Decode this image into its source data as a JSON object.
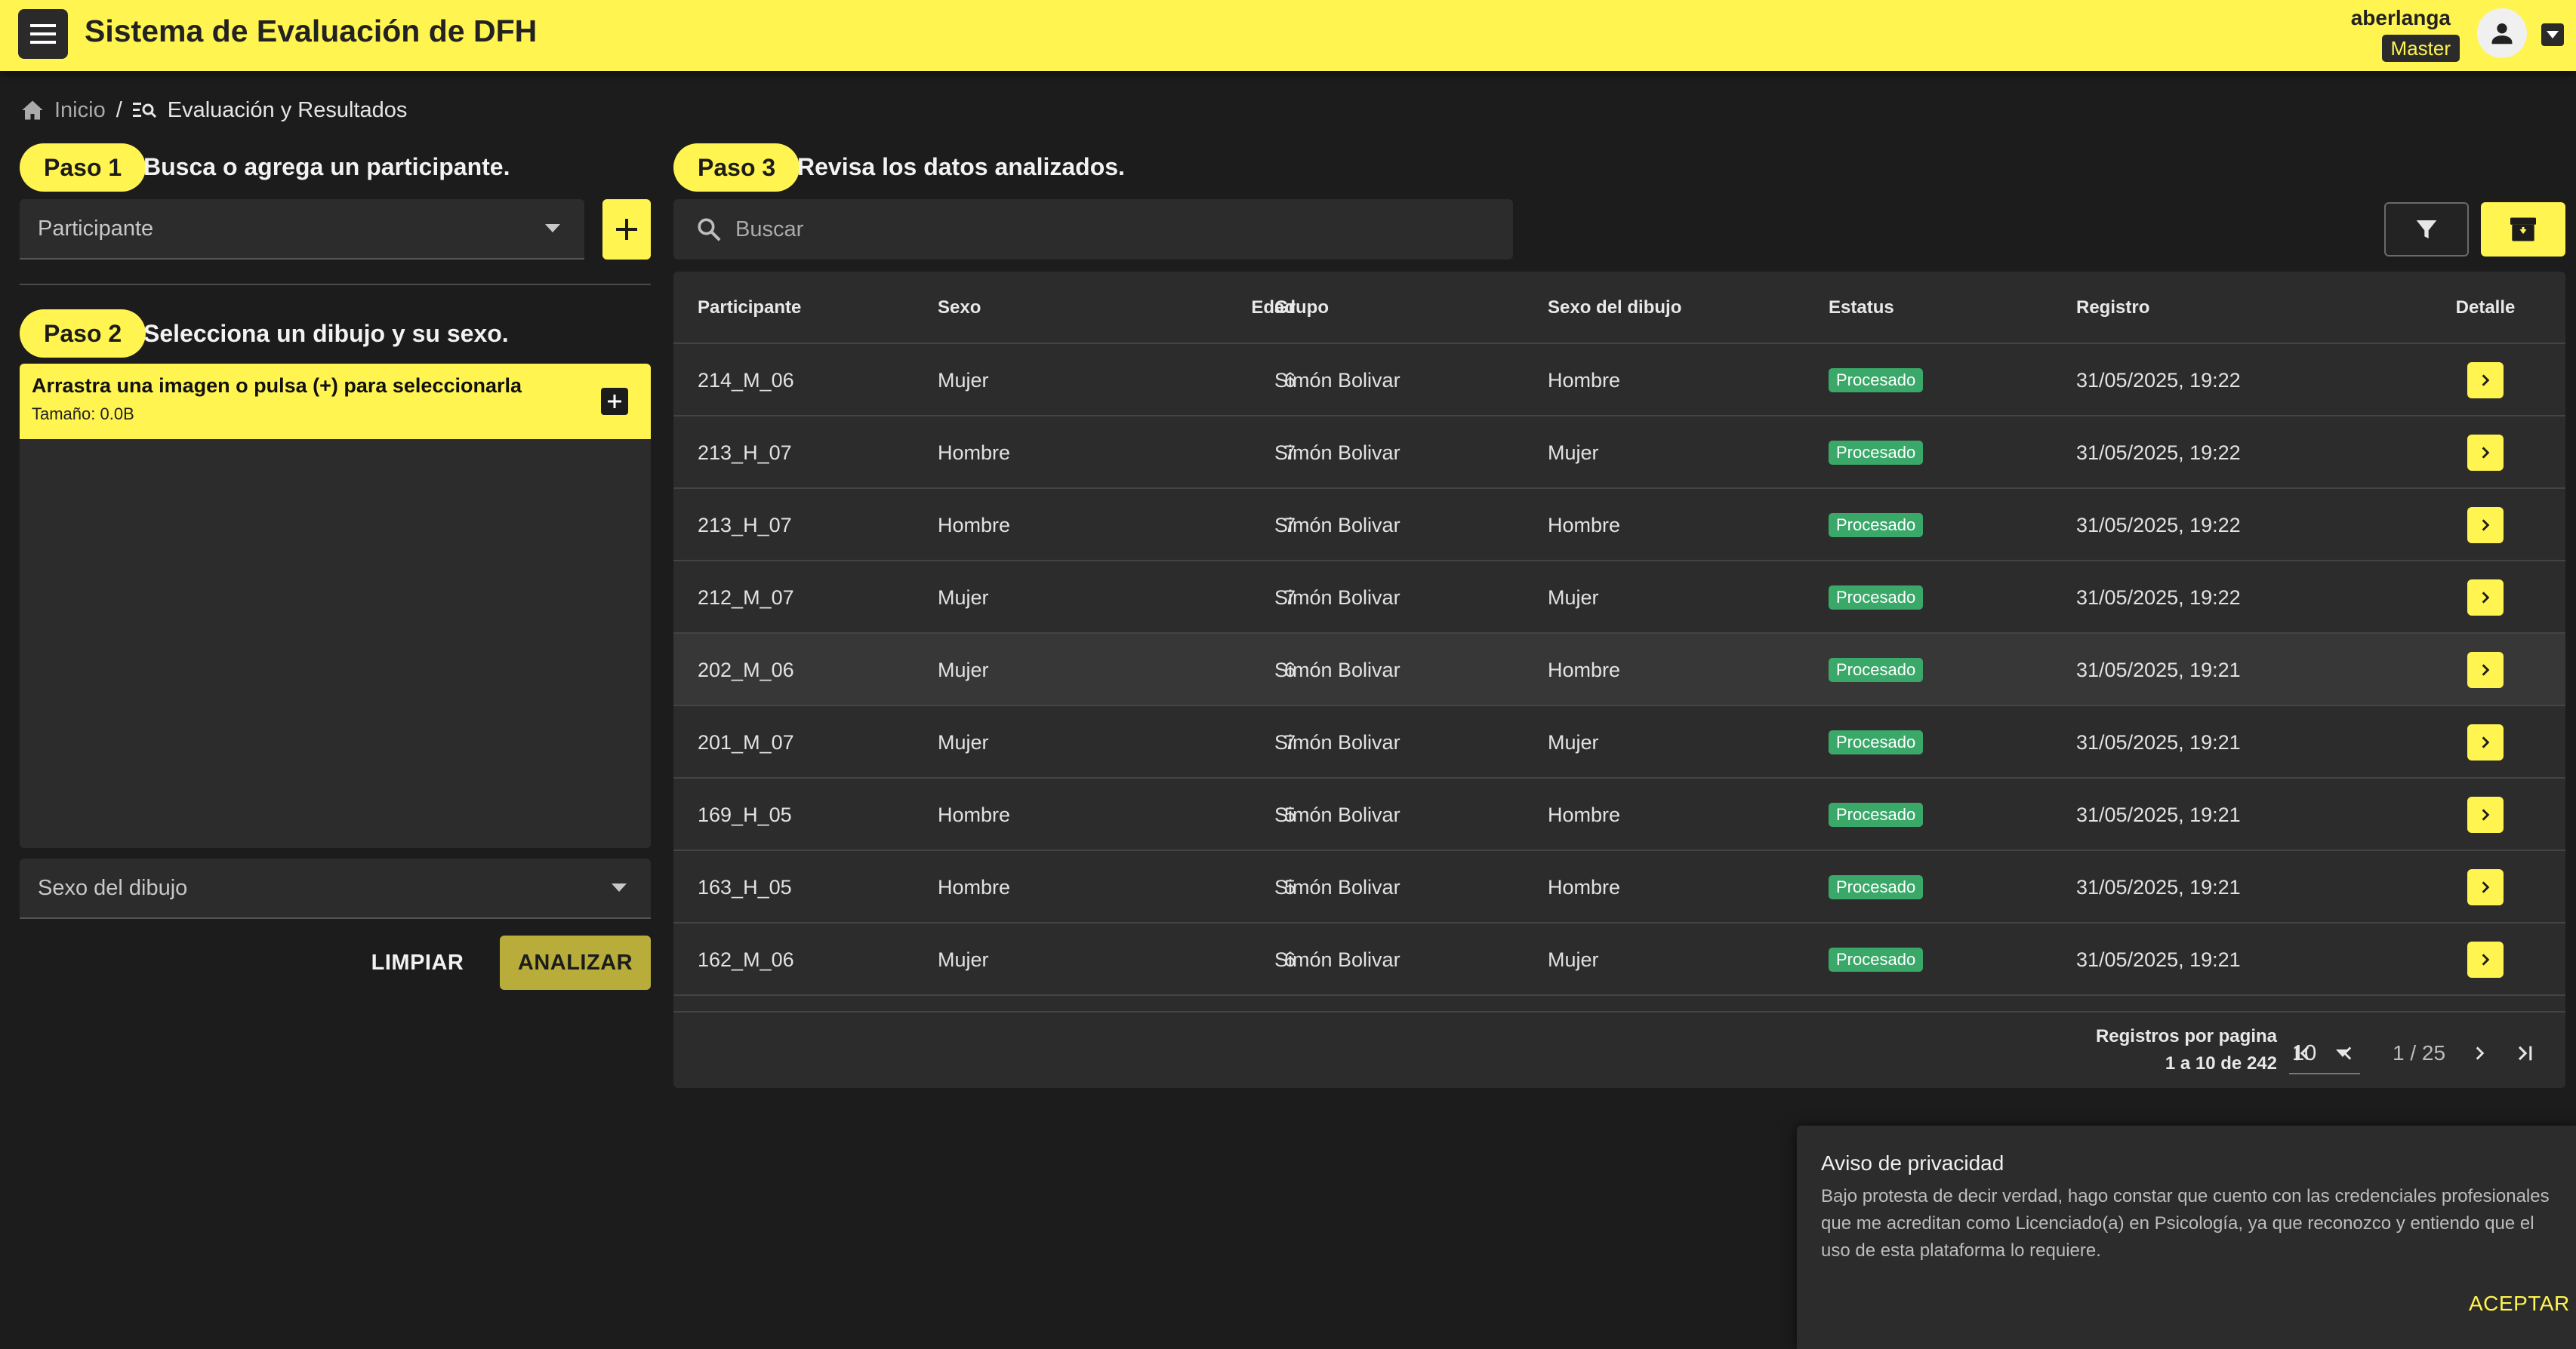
{
  "app": {
    "title": "Sistema de Evaluación de DFH"
  },
  "user": {
    "name": "aberlanga",
    "role": "Master"
  },
  "breadcrumb": {
    "home": "Inicio",
    "separator": "/",
    "current": "Evaluación y Resultados"
  },
  "step1": {
    "pill": "Paso 1",
    "text": "Busca o agrega un participante.",
    "participant_placeholder": "Participante"
  },
  "step2": {
    "pill": "Paso 2",
    "text": "Selecciona un dibujo y su sexo.",
    "upload_title": "Arrastra una imagen o pulsa (+) para seleccionarla",
    "upload_size": "Tamaño: 0.0B",
    "drawing_sex_placeholder": "Sexo del dibujo",
    "clear_label": "LIMPIAR",
    "analyze_label": "ANALIZAR"
  },
  "step3": {
    "pill": "Paso 3",
    "text": "Revisa los datos analizados.",
    "search_placeholder": "Buscar"
  },
  "table": {
    "columns": [
      "Participante",
      "Sexo",
      "Edad",
      "Grupo",
      "Sexo del dibujo",
      "Estatus",
      "Registro",
      "Detalle"
    ],
    "rows": [
      {
        "participante": "214_M_06",
        "sexo": "Mujer",
        "edad": "6",
        "grupo": "Simón Bolivar",
        "sexo_dibujo": "Hombre",
        "estatus": "Procesado",
        "registro": "31/05/2025, 19:22"
      },
      {
        "participante": "213_H_07",
        "sexo": "Hombre",
        "edad": "7",
        "grupo": "Simón Bolivar",
        "sexo_dibujo": "Mujer",
        "estatus": "Procesado",
        "registro": "31/05/2025, 19:22"
      },
      {
        "participante": "213_H_07",
        "sexo": "Hombre",
        "edad": "7",
        "grupo": "Simón Bolivar",
        "sexo_dibujo": "Hombre",
        "estatus": "Procesado",
        "registro": "31/05/2025, 19:22"
      },
      {
        "participante": "212_M_07",
        "sexo": "Mujer",
        "edad": "7",
        "grupo": "Simón Bolivar",
        "sexo_dibujo": "Mujer",
        "estatus": "Procesado",
        "registro": "31/05/2025, 19:22"
      },
      {
        "participante": "202_M_06",
        "sexo": "Mujer",
        "edad": "6",
        "grupo": "Simón Bolivar",
        "sexo_dibujo": "Hombre",
        "estatus": "Procesado",
        "registro": "31/05/2025, 19:21"
      },
      {
        "participante": "201_M_07",
        "sexo": "Mujer",
        "edad": "7",
        "grupo": "Simón Bolivar",
        "sexo_dibujo": "Mujer",
        "estatus": "Procesado",
        "registro": "31/05/2025, 19:21"
      },
      {
        "participante": "169_H_05",
        "sexo": "Hombre",
        "edad": "5",
        "grupo": "Simón Bolivar",
        "sexo_dibujo": "Hombre",
        "estatus": "Procesado",
        "registro": "31/05/2025, 19:21"
      },
      {
        "participante": "163_H_05",
        "sexo": "Hombre",
        "edad": "5",
        "grupo": "Simón Bolivar",
        "sexo_dibujo": "Hombre",
        "estatus": "Procesado",
        "registro": "31/05/2025, 19:21"
      },
      {
        "participante": "162_M_06",
        "sexo": "Mujer",
        "edad": "6",
        "grupo": "Simón Bolivar",
        "sexo_dibujo": "Mujer",
        "estatus": "Procesado",
        "registro": "31/05/2025, 19:21"
      }
    ],
    "hovered_row": 4
  },
  "pagination": {
    "rows_per_page_label": "Registros por pagina",
    "range": "1 a 10 de 242",
    "rows_per_page": "10",
    "pages": "1 / 25"
  },
  "privacy": {
    "title": "Aviso de privacidad",
    "body": "Bajo protesta de decir verdad, hago constar que cuento con las credenciales profesionales que me acreditan como Licenciado(a) en Psicología, ya que reconozco y entiendo que el uso de esta plataforma lo requiere.",
    "accept_label": "ACEPTAR"
  },
  "colors": {
    "accent": "#fff450",
    "background": "#1c1c1c",
    "surface": "#2c2c2c",
    "status_processed": "#3aa869",
    "analyze_button": "#b8ad3b"
  },
  "icons": {
    "menu": "menu-icon",
    "account": "account-circle-icon",
    "home": "home-icon",
    "evaluation": "manage-search-icon",
    "add": "plus-icon",
    "search": "search-icon",
    "filter": "filter-icon",
    "archive": "archive-icon",
    "detail": "chevron-right-icon"
  }
}
